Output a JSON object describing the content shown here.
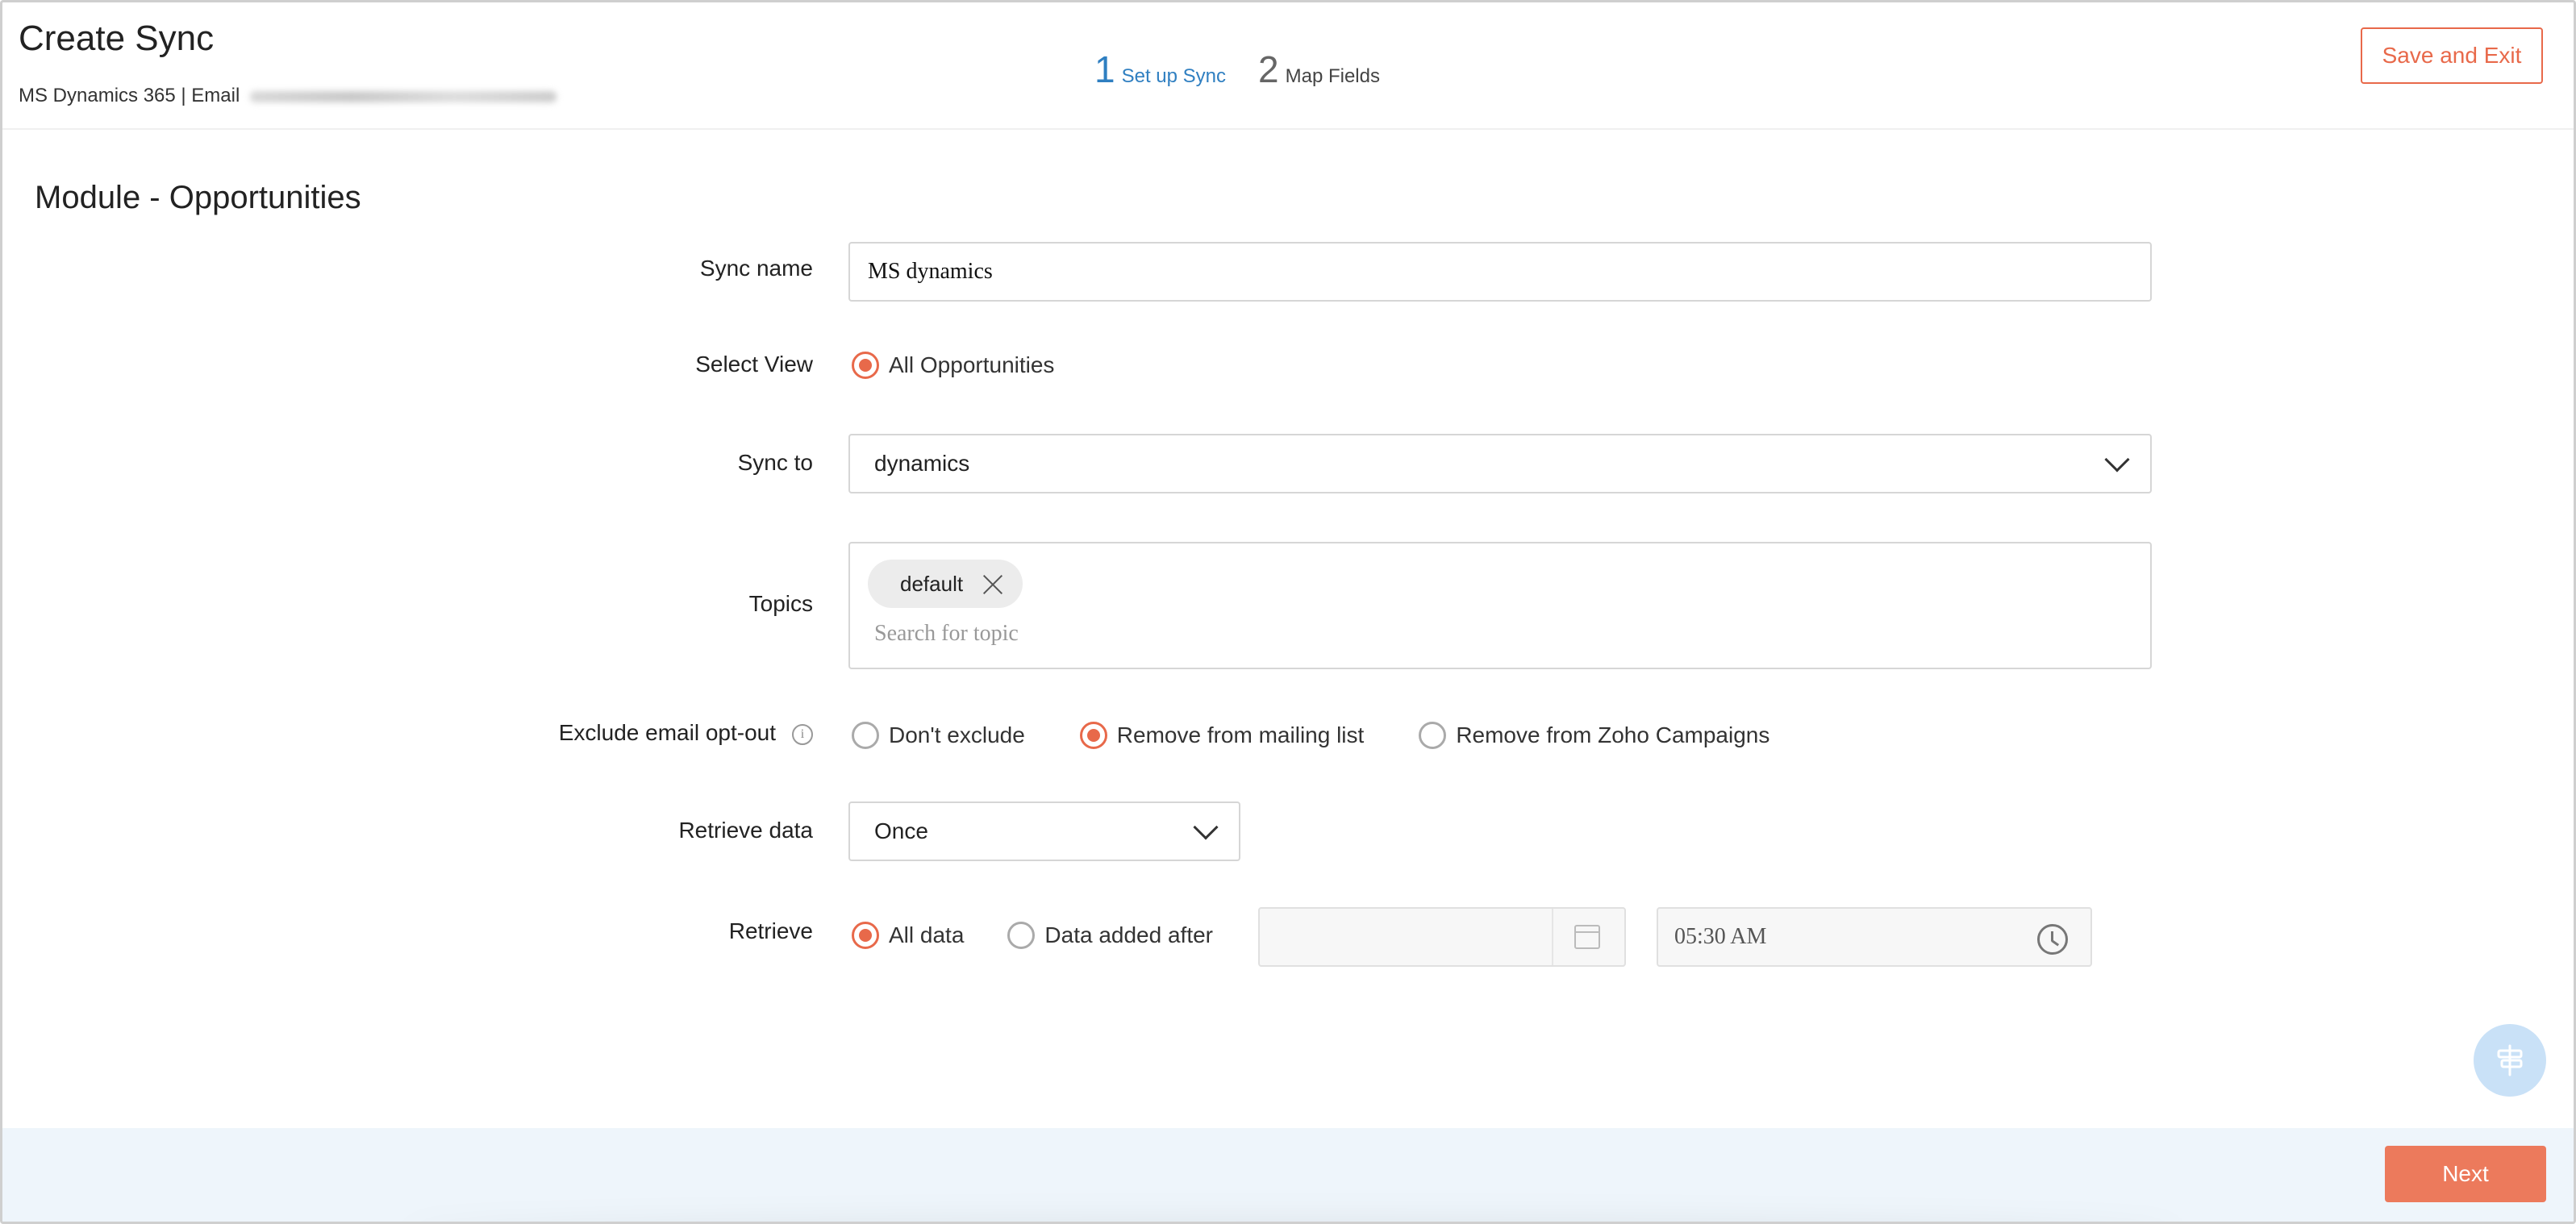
{
  "header": {
    "title": "Create Sync",
    "subtitle": "MS Dynamics 365 | Email",
    "steps": [
      {
        "number": "1",
        "label": "Set up Sync"
      },
      {
        "number": "2",
        "label": "Map Fields"
      }
    ],
    "save_exit_label": "Save and Exit"
  },
  "module_title": "Module - Opportunities",
  "form": {
    "sync_name": {
      "label": "Sync name",
      "value": "MS dynamics"
    },
    "select_view": {
      "label": "Select View",
      "option": "All Opportunities"
    },
    "sync_to": {
      "label": "Sync to",
      "value": "dynamics"
    },
    "topics": {
      "label": "Topics",
      "chip": "default",
      "placeholder": "Search for topic"
    },
    "exclude_opt_out": {
      "label": "Exclude email opt-out",
      "options": [
        "Don't exclude",
        "Remove from mailing list",
        "Remove from Zoho Campaigns"
      ],
      "selected": "Remove from mailing list"
    },
    "retrieve_data": {
      "label": "Retrieve data",
      "value": "Once"
    },
    "retrieve": {
      "label": "Retrieve",
      "options": [
        "All data",
        "Data added after"
      ],
      "selected": "All data",
      "time_value": "05:30 AM"
    }
  },
  "footer": {
    "next_label": "Next"
  },
  "colors": {
    "accent": "#e8694a",
    "link": "#2f7fc1",
    "footer_bg": "#eef5fb"
  },
  "icons": {
    "info": "info-icon",
    "calendar": "calendar-icon",
    "clock": "clock-icon",
    "close": "close-icon",
    "chevron": "chevron-down-icon",
    "help": "help-fab-icon"
  }
}
